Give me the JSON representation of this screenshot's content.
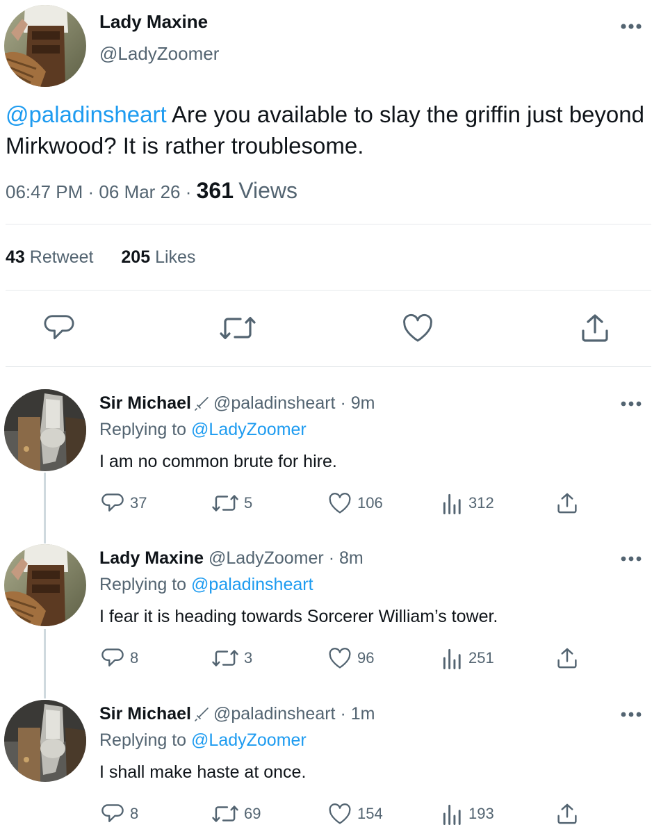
{
  "tweet": {
    "author_name": "Lady Maxine",
    "author_handle": "@LadyZoomer",
    "mention": "@paladinsheart",
    "text": " Are you available to slay the griffin just beyond Mirkwood? It is rather troublesome.",
    "time": "06:47 PM",
    "date": "06 Mar 26",
    "views_count": "361",
    "views_label": "Views",
    "retweets_count": "43",
    "retweets_label": "Retweet",
    "likes_count": "205",
    "likes_label": "Likes",
    "icons": [
      "more-icon",
      "reply-icon",
      "retweet-icon",
      "like-icon",
      "share-icon"
    ]
  },
  "replies": [
    {
      "name": "Sir Michael",
      "handle": "@paladinsheart",
      "time": "9m",
      "replying_label": "Replying to",
      "replying_to": "@LadyZoomer",
      "text": "I am no common brute for hire.",
      "reply_count": "37",
      "retweet_count": "5",
      "like_count": "106",
      "view_count": "312",
      "badge_icon": "sword-icon"
    },
    {
      "name": "Lady Maxine",
      "handle": "@LadyZoomer",
      "time": "8m",
      "replying_label": "Replying to",
      "replying_to": "@paladinsheart",
      "text": "I fear it is heading towards Sorcerer William’s tower.",
      "reply_count": "8",
      "retweet_count": "3",
      "like_count": "96",
      "view_count": "251"
    },
    {
      "name": "Sir Michael",
      "handle": "@paladinsheart",
      "time": "1m",
      "replying_label": "Replying to",
      "replying_to": "@LadyZoomer",
      "text": "I shall make haste at once.",
      "reply_count": "8",
      "retweet_count": "69",
      "like_count": "154",
      "view_count": "193",
      "badge_icon": "sword-icon"
    }
  ],
  "colors": {
    "accent": "#1d9bf0",
    "text": "#0f1419",
    "secondary": "#536471",
    "divider": "#e6e9ec",
    "thread_line": "#cfd9de"
  }
}
